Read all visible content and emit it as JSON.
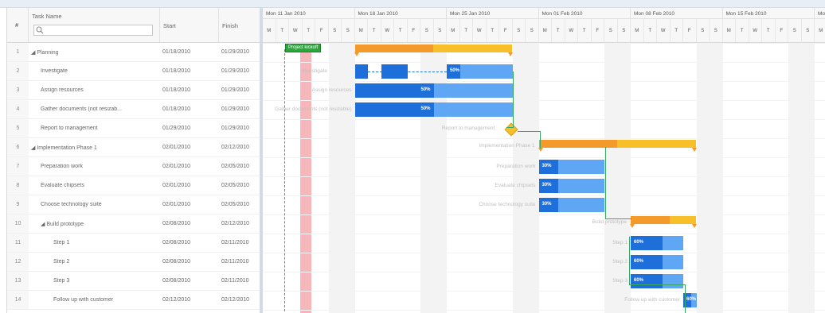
{
  "grid": {
    "headers": {
      "num": "#",
      "name": "Task Name",
      "start": "Start",
      "finish": "Finish"
    },
    "search_placeholder": "",
    "rows": [
      {
        "num": "1",
        "name": "◢ Planning",
        "start": "01/18/2010",
        "finish": "01/29/2010"
      },
      {
        "num": "2",
        "name": "Investigate",
        "start": "01/18/2010",
        "finish": "01/29/2010"
      },
      {
        "num": "3",
        "name": "Assign resources",
        "start": "01/18/2010",
        "finish": "01/29/2010"
      },
      {
        "num": "4",
        "name": "Gather documents (not resizab...",
        "start": "01/18/2010",
        "finish": "01/29/2010"
      },
      {
        "num": "5",
        "name": "Report to management",
        "start": "01/29/2010",
        "finish": "01/29/2010"
      },
      {
        "num": "6",
        "name": "◢ Implementation Phase 1",
        "start": "02/01/2010",
        "finish": "02/12/2010"
      },
      {
        "num": "7",
        "name": "Preparation work",
        "start": "02/01/2010",
        "finish": "02/05/2010"
      },
      {
        "num": "8",
        "name": "Evaluate chipsets",
        "start": "02/01/2010",
        "finish": "02/05/2010"
      },
      {
        "num": "9",
        "name": "Choose technology suite",
        "start": "02/01/2010",
        "finish": "02/05/2010"
      },
      {
        "num": "10",
        "name": "◢ Build prototype",
        "start": "02/08/2010",
        "finish": "02/12/2010"
      },
      {
        "num": "11",
        "name": "Step 1",
        "start": "02/08/2010",
        "finish": "02/11/2010"
      },
      {
        "num": "12",
        "name": "Step 2",
        "start": "02/08/2010",
        "finish": "02/11/2010"
      },
      {
        "num": "13",
        "name": "Step 3",
        "start": "02/08/2010",
        "finish": "02/11/2010"
      },
      {
        "num": "14",
        "name": "Follow up with customer",
        "start": "02/12/2010",
        "finish": "02/12/2010"
      }
    ]
  },
  "timeline": {
    "weeks": [
      "Mon 11 Jan 2010",
      "Mon 18 Jan 2010",
      "Mon 25 Jan 2010",
      "Mon 01 Feb 2010",
      "Mon 08 Feb 2010",
      "Mon 15 Feb 2010",
      "Mon"
    ],
    "days": [
      "M",
      "T",
      "W",
      "T",
      "F",
      "S",
      "S"
    ],
    "milestone_label": "Project kickoff",
    "colors": {
      "summary": "#f7c02a",
      "summary_done": "#f39a2b",
      "task": "#5fa7f5",
      "task_done": "#1e6fd9",
      "today": "#f7b6ba",
      "milestone": "#2aa83c"
    },
    "bars": [
      {
        "row": 0,
        "kind": "summary",
        "startDay": 7,
        "days": 12,
        "progress": 0.5,
        "label": "",
        "pct": ""
      },
      {
        "row": 1,
        "kind": "segment",
        "label": "Investigate",
        "pct": "50%"
      },
      {
        "row": 2,
        "kind": "task",
        "startDay": 7,
        "days": 12,
        "progress": 0.5,
        "label": "Assign resources",
        "pct": "50%"
      },
      {
        "row": 3,
        "kind": "task",
        "startDay": 7,
        "days": 12,
        "progress": 0.5,
        "label": "Gather documents (not resizable)",
        "pct": "50%"
      },
      {
        "row": 4,
        "kind": "milestone",
        "startDay": 18.5,
        "label": "Report to management",
        "pct": ""
      },
      {
        "row": 5,
        "kind": "summary",
        "startDay": 21,
        "days": 12,
        "progress": 0.5,
        "label": "Implementation Phase 1",
        "pct": ""
      },
      {
        "row": 6,
        "kind": "task",
        "startDay": 21,
        "days": 5,
        "progress": 0.3,
        "label": "Preparation work",
        "pct": "30%"
      },
      {
        "row": 7,
        "kind": "task",
        "startDay": 21,
        "days": 5,
        "progress": 0.3,
        "label": "Evaluate chipsets",
        "pct": "30%"
      },
      {
        "row": 8,
        "kind": "task",
        "startDay": 21,
        "days": 5,
        "progress": 0.3,
        "label": "Choose technology suite",
        "pct": "30%"
      },
      {
        "row": 9,
        "kind": "summary",
        "startDay": 28,
        "days": 5,
        "progress": 0.6,
        "label": "Build prototype",
        "pct": ""
      },
      {
        "row": 10,
        "kind": "task",
        "startDay": 28,
        "days": 4,
        "progress": 0.6,
        "label": "Step 1",
        "pct": "60%"
      },
      {
        "row": 11,
        "kind": "task",
        "startDay": 28,
        "days": 4,
        "progress": 0.6,
        "label": "Step 2",
        "pct": "60%"
      },
      {
        "row": 12,
        "kind": "task",
        "startDay": 28,
        "days": 4,
        "progress": 0.6,
        "label": "Step 3",
        "pct": "60%"
      },
      {
        "row": 13,
        "kind": "task",
        "startDay": 32,
        "days": 1,
        "progress": 0.6,
        "label": "Follow up with customer",
        "pct": "60%"
      }
    ]
  }
}
